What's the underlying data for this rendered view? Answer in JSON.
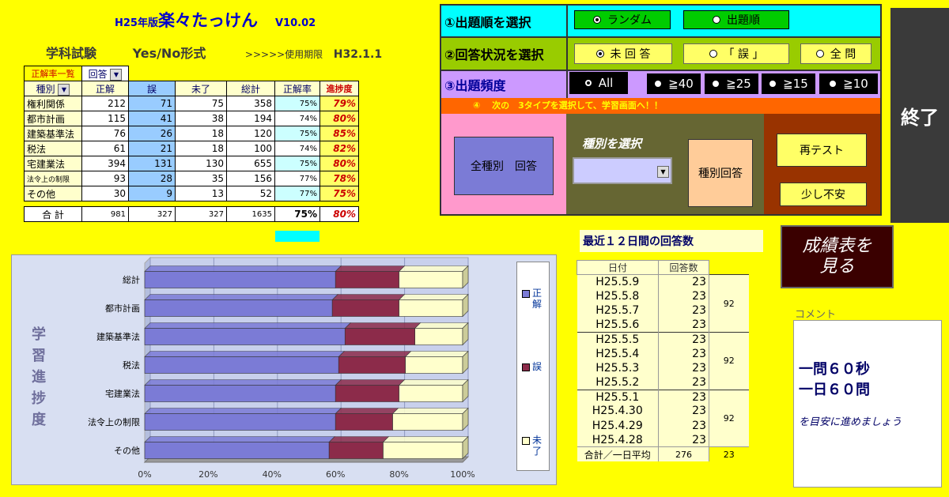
{
  "header": {
    "prefix": "H25年版",
    "title": "楽々たっけん",
    "version": "V10.02",
    "subject": "学科試験",
    "format": "Yes/No形式",
    "expiry_label": ">>>>>使用期限",
    "expiry_value": "H32.1.1"
  },
  "score_table": {
    "caption": "正解率一覧",
    "filter_value": "回答",
    "col_headers": [
      "種別",
      "正解",
      "誤",
      "未了",
      "総計",
      "正解率",
      "進捗度"
    ],
    "rows": [
      {
        "name": "権利関係",
        "ok": "212",
        "ng": "71",
        "un": "75",
        "total": "358",
        "rate": "75%",
        "progress": "79%"
      },
      {
        "name": "都市計画",
        "ok": "115",
        "ng": "41",
        "un": "38",
        "total": "194",
        "rate": "74%",
        "progress": "80%"
      },
      {
        "name": "建築基準法",
        "ok": "76",
        "ng": "26",
        "un": "18",
        "total": "120",
        "rate": "75%",
        "progress": "85%"
      },
      {
        "name": "税法",
        "ok": "61",
        "ng": "21",
        "un": "18",
        "total": "100",
        "rate": "74%",
        "progress": "82%"
      },
      {
        "name": "宅建業法",
        "ok": "394",
        "ng": "131",
        "un": "130",
        "total": "655",
        "rate": "75%",
        "progress": "80%"
      },
      {
        "name": "法令上の制限",
        "ok": "93",
        "ng": "28",
        "un": "35",
        "total": "156",
        "rate": "77%",
        "progress": "78%"
      },
      {
        "name": "その他",
        "ok": "30",
        "ng": "9",
        "un": "13",
        "total": "52",
        "rate": "77%",
        "progress": "75%"
      }
    ],
    "total_row": {
      "name": "合 計",
      "ok": "981",
      "ng": "327",
      "un": "327",
      "total": "1635",
      "rate": "75%",
      "progress": "80%"
    }
  },
  "panel": {
    "row1_label": "①出題順を選択",
    "row1_options": [
      "ランダム",
      "出題順"
    ],
    "row2_label": "②回答状況を選択",
    "row2_options": [
      "未 回 答",
      "「 誤 」",
      "全 問"
    ],
    "row3_label": "③出題頻度",
    "row3_options": [
      "All",
      "≧40",
      "≧25",
      "≧15",
      "≧10"
    ],
    "row4_text": "④　 次の　3タイプを選択して、学習画面へ！！",
    "all_types_btn": "全種別　回答",
    "select_type_label": "種別を選択",
    "type_answer_btn": "種別回答",
    "retest_btn": "再テスト",
    "unsure_btn": "少し不安"
  },
  "end_button": "終了",
  "report_button": [
    "成績表を",
    "見る"
  ],
  "daily": {
    "title": "最近１２日間の回答数",
    "headers": [
      "日付",
      "回答数"
    ],
    "rows": [
      {
        "date": "H25.5.9",
        "count": "23"
      },
      {
        "date": "H25.5.8",
        "count": "23"
      },
      {
        "date": "H25.5.7",
        "count": "23"
      },
      {
        "date": "H25.5.6",
        "count": "23"
      },
      {
        "date": "H25.5.5",
        "count": "23"
      },
      {
        "date": "H25.5.4",
        "count": "23"
      },
      {
        "date": "H25.5.3",
        "count": "23"
      },
      {
        "date": "H25.5.2",
        "count": "23"
      },
      {
        "date": "H25.5.1",
        "count": "23"
      },
      {
        "date": "H25.4.30",
        "count": "23"
      },
      {
        "date": "H25.4.29",
        "count": "23"
      },
      {
        "date": "H25.4.28",
        "count": "23"
      }
    ],
    "group_sums": [
      "92",
      "92",
      "92"
    ],
    "footer_label": "合計／一日平均",
    "footer_total": "276",
    "footer_avg": "23"
  },
  "comment": {
    "label": "コメント",
    "main_line1": "一問６０秒",
    "main_line2": "一日６０問",
    "sub": "を目安に進めましょう"
  },
  "chart_side_label": [
    "学",
    "習",
    "進",
    "捗",
    "度"
  ],
  "colors": {
    "ok": "#7b7bd6",
    "ng": "#8c2b4a",
    "un": "#ffffcc"
  },
  "chart_data": {
    "type": "bar",
    "orientation": "horizontal-stacked-100",
    "categories": [
      "総計",
      "都市計画",
      "建築基準法",
      "税法",
      "宅建業法",
      "法令上の制限",
      "その他"
    ],
    "series": [
      {
        "name": "正解",
        "values": [
          60,
          59,
          63,
          61,
          60,
          60,
          58
        ]
      },
      {
        "name": "誤",
        "values": [
          20,
          21,
          22,
          21,
          20,
          18,
          17
        ]
      },
      {
        "name": "未了",
        "values": [
          20,
          20,
          15,
          18,
          20,
          22,
          25
        ]
      }
    ],
    "xticks": [
      "0%",
      "20%",
      "40%",
      "60%",
      "80%",
      "100%"
    ],
    "xlim": [
      0,
      100
    ],
    "legend": "right"
  }
}
